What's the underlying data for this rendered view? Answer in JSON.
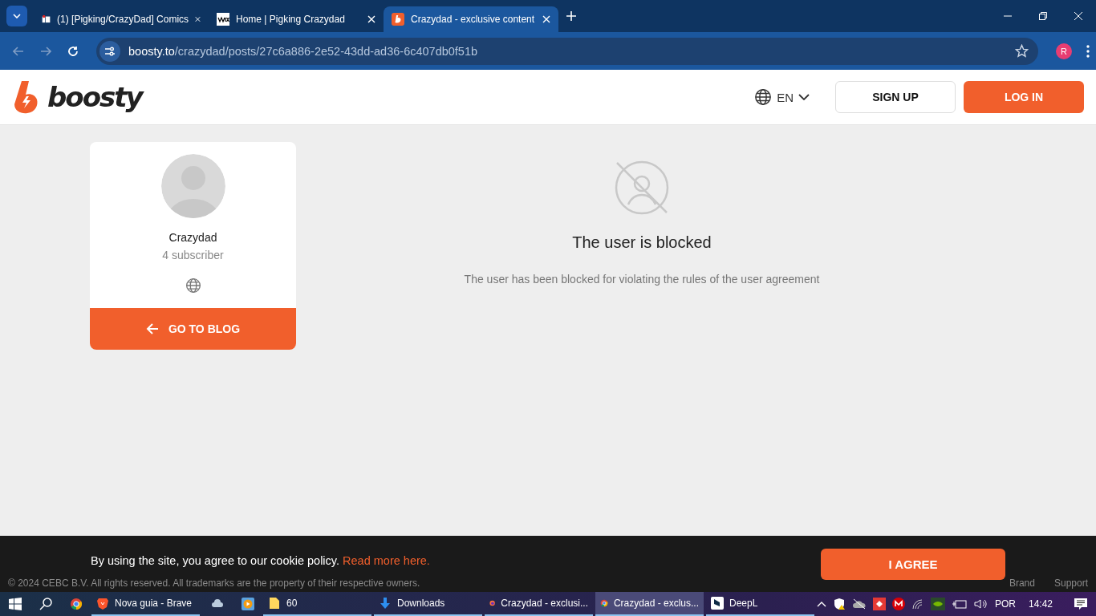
{
  "browser": {
    "tabs": [
      {
        "title": "(1) [Pigking/CrazyDad] Comics",
        "selected": false
      },
      {
        "title": "Home | Pigking Crazydad",
        "selected": false
      },
      {
        "title": "Crazydad - exclusive content",
        "selected": true
      }
    ],
    "url_host": "boosty.to",
    "url_path": "/crazydad/posts/27c6a886-2e52-43dd-ad36-6c407db0f51b",
    "profile_initial": "R"
  },
  "header": {
    "logo_text": "boosty",
    "language": "EN",
    "sign_up": "SIGN UP",
    "log_in": "LOG IN"
  },
  "profile": {
    "name": "Crazydad",
    "subscribers": "4 subscriber",
    "go_to_blog": "GO TO BLOG"
  },
  "blocked": {
    "title": "The user is blocked",
    "message": "The user has been blocked for violating the rules of the user agreement"
  },
  "cookie_banner": {
    "text": "By using the site, you agree to our cookie policy.",
    "link": "Read more here.",
    "button": "I AGREE"
  },
  "footer": {
    "copyright": "© 2024 CEBC B.V. All rights reserved. All trademarks are the property of their respective owners.",
    "links": [
      "Brand",
      "Support"
    ]
  },
  "taskbar": {
    "items": [
      {
        "label": "Nova guia - Brave",
        "selected": false
      },
      {
        "label": "60",
        "selected": false
      },
      {
        "label": "Downloads",
        "selected": false
      },
      {
        "label": "Crazydad - exclusi...",
        "selected": false
      },
      {
        "label": "Crazydad - exclus...",
        "selected": true
      },
      {
        "label": "DeepL",
        "selected": false
      }
    ],
    "language": "POR",
    "time": "14:42"
  }
}
